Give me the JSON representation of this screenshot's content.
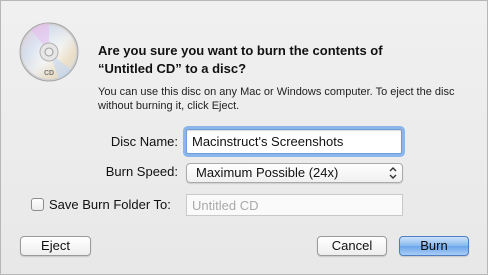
{
  "dialog": {
    "title": "Are you sure you want to burn the contents of\n“Untitled CD” to a disc?",
    "message": "You can use this disc on any Mac or Windows computer. To eject the disc without burning it, click Eject.",
    "icon": "cd-disc-icon",
    "icon_text": "CD"
  },
  "form": {
    "disc_name_label": "Disc Name:",
    "disc_name_value": "Macinstruct's Screenshots",
    "burn_speed_label": "Burn Speed:",
    "burn_speed_value": "Maximum Possible (24x)",
    "save_folder_label": "Save Burn Folder To:",
    "save_folder_checked": false,
    "save_folder_placeholder": "Untitled CD"
  },
  "buttons": {
    "eject": "Eject",
    "cancel": "Cancel",
    "burn": "Burn"
  },
  "colors": {
    "accent": "#6ba4ea",
    "focus_ring": "#8bb6ec"
  }
}
